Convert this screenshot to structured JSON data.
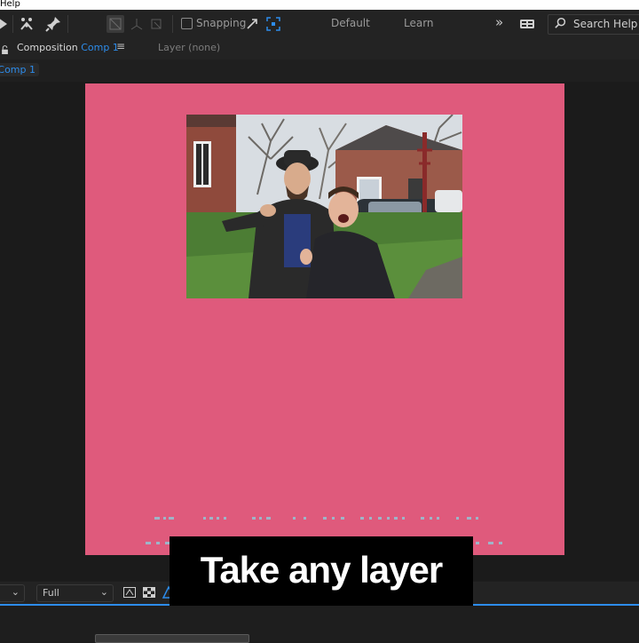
{
  "menubar": {
    "help_label": "Help"
  },
  "toolbar": {
    "snapping_label": "Snapping",
    "snapping_checked": false,
    "workspace_default": "Default",
    "workspace_learn": "Learn",
    "overflow_glyph": "»",
    "search_label": "Search Help"
  },
  "panel": {
    "tab_prefix": "Composition ",
    "comp_name": "Comp 1",
    "menu_glyph": "≡",
    "layer_tab": "Layer (none)"
  },
  "comp_chip": {
    "label": "Comp 1"
  },
  "viewer": {
    "canvas_color": "#df5a7c",
    "photo_description_icon": "photo-layer-image"
  },
  "footer": {
    "resolution_value": "Full",
    "caret_glyph": "⌄"
  },
  "caption": {
    "text": "Take any layer"
  },
  "colors": {
    "accent": "#2d8ceb",
    "panel_bg": "#232323",
    "viewer_bg": "#1b1b1b"
  }
}
